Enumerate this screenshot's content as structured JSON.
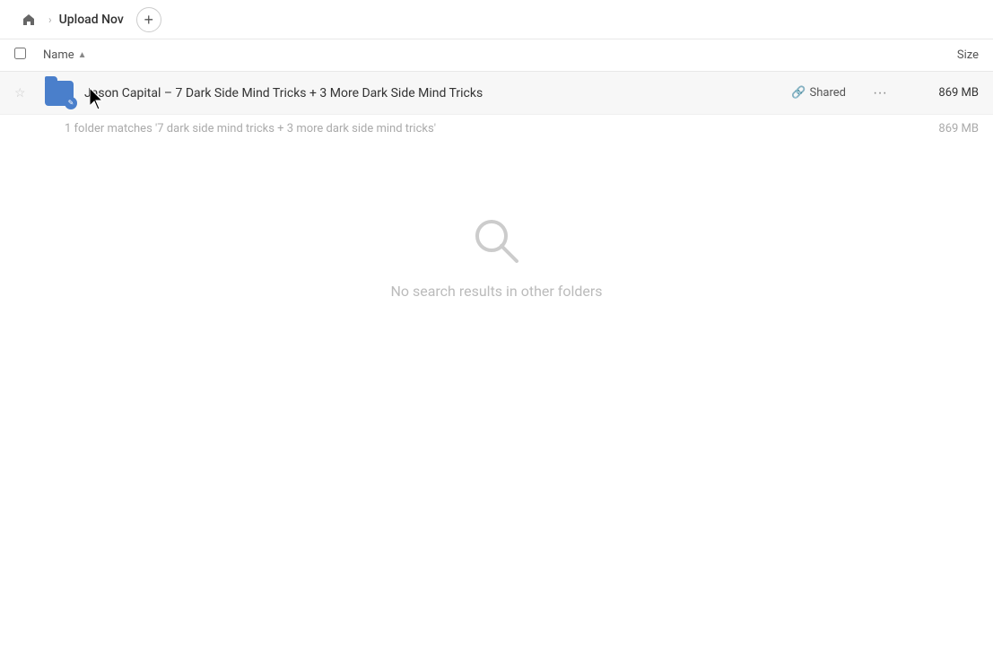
{
  "topbar": {
    "home_tooltip": "Home",
    "breadcrumb": "Upload Nov",
    "add_label": "+"
  },
  "columns": {
    "name_label": "Name",
    "sort_arrow": "▲",
    "size_label": "Size"
  },
  "file_row": {
    "name": "Jason Capital – 7 Dark Side Mind Tricks + 3 More Dark Side Mind Tricks",
    "shared_label": "Shared",
    "size": "869 MB",
    "more_icon": "···"
  },
  "match_info": {
    "text": "1 folder matches '7 dark side mind tricks + 3 more dark side mind tricks'",
    "size": "869 MB"
  },
  "empty_state": {
    "message": "No search results in other folders"
  },
  "icons": {
    "home": "⌂",
    "chevron": "›",
    "star_empty": "☆",
    "link": "🔗",
    "pencil": "✎",
    "search": "🔍"
  }
}
